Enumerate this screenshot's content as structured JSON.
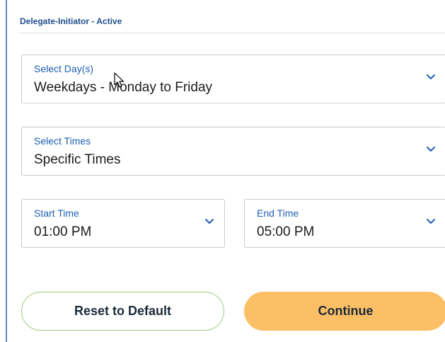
{
  "header": {
    "title": "Delegate-Initiator - Active"
  },
  "form": {
    "days": {
      "label": "Select Day(s)",
      "value": "Weekdays - Monday to Friday"
    },
    "times": {
      "label": "Select Times",
      "value": "Specific Times"
    },
    "start_time": {
      "label": "Start Time",
      "value": "01:00 PM"
    },
    "end_time": {
      "label": "End Time",
      "value": "05:00 PM"
    }
  },
  "buttons": {
    "reset_label": "Reset to Default",
    "continue_label": "Continue"
  },
  "colors": {
    "accent_blue": "#1f5fb4",
    "header_blue": "#1f4e8c",
    "continue_orange": "#fcbf65",
    "reset_border_green": "#9ccf82"
  },
  "icons": {
    "dropdown": "chevron-down-icon",
    "pointer": "mouse-cursor-icon"
  }
}
